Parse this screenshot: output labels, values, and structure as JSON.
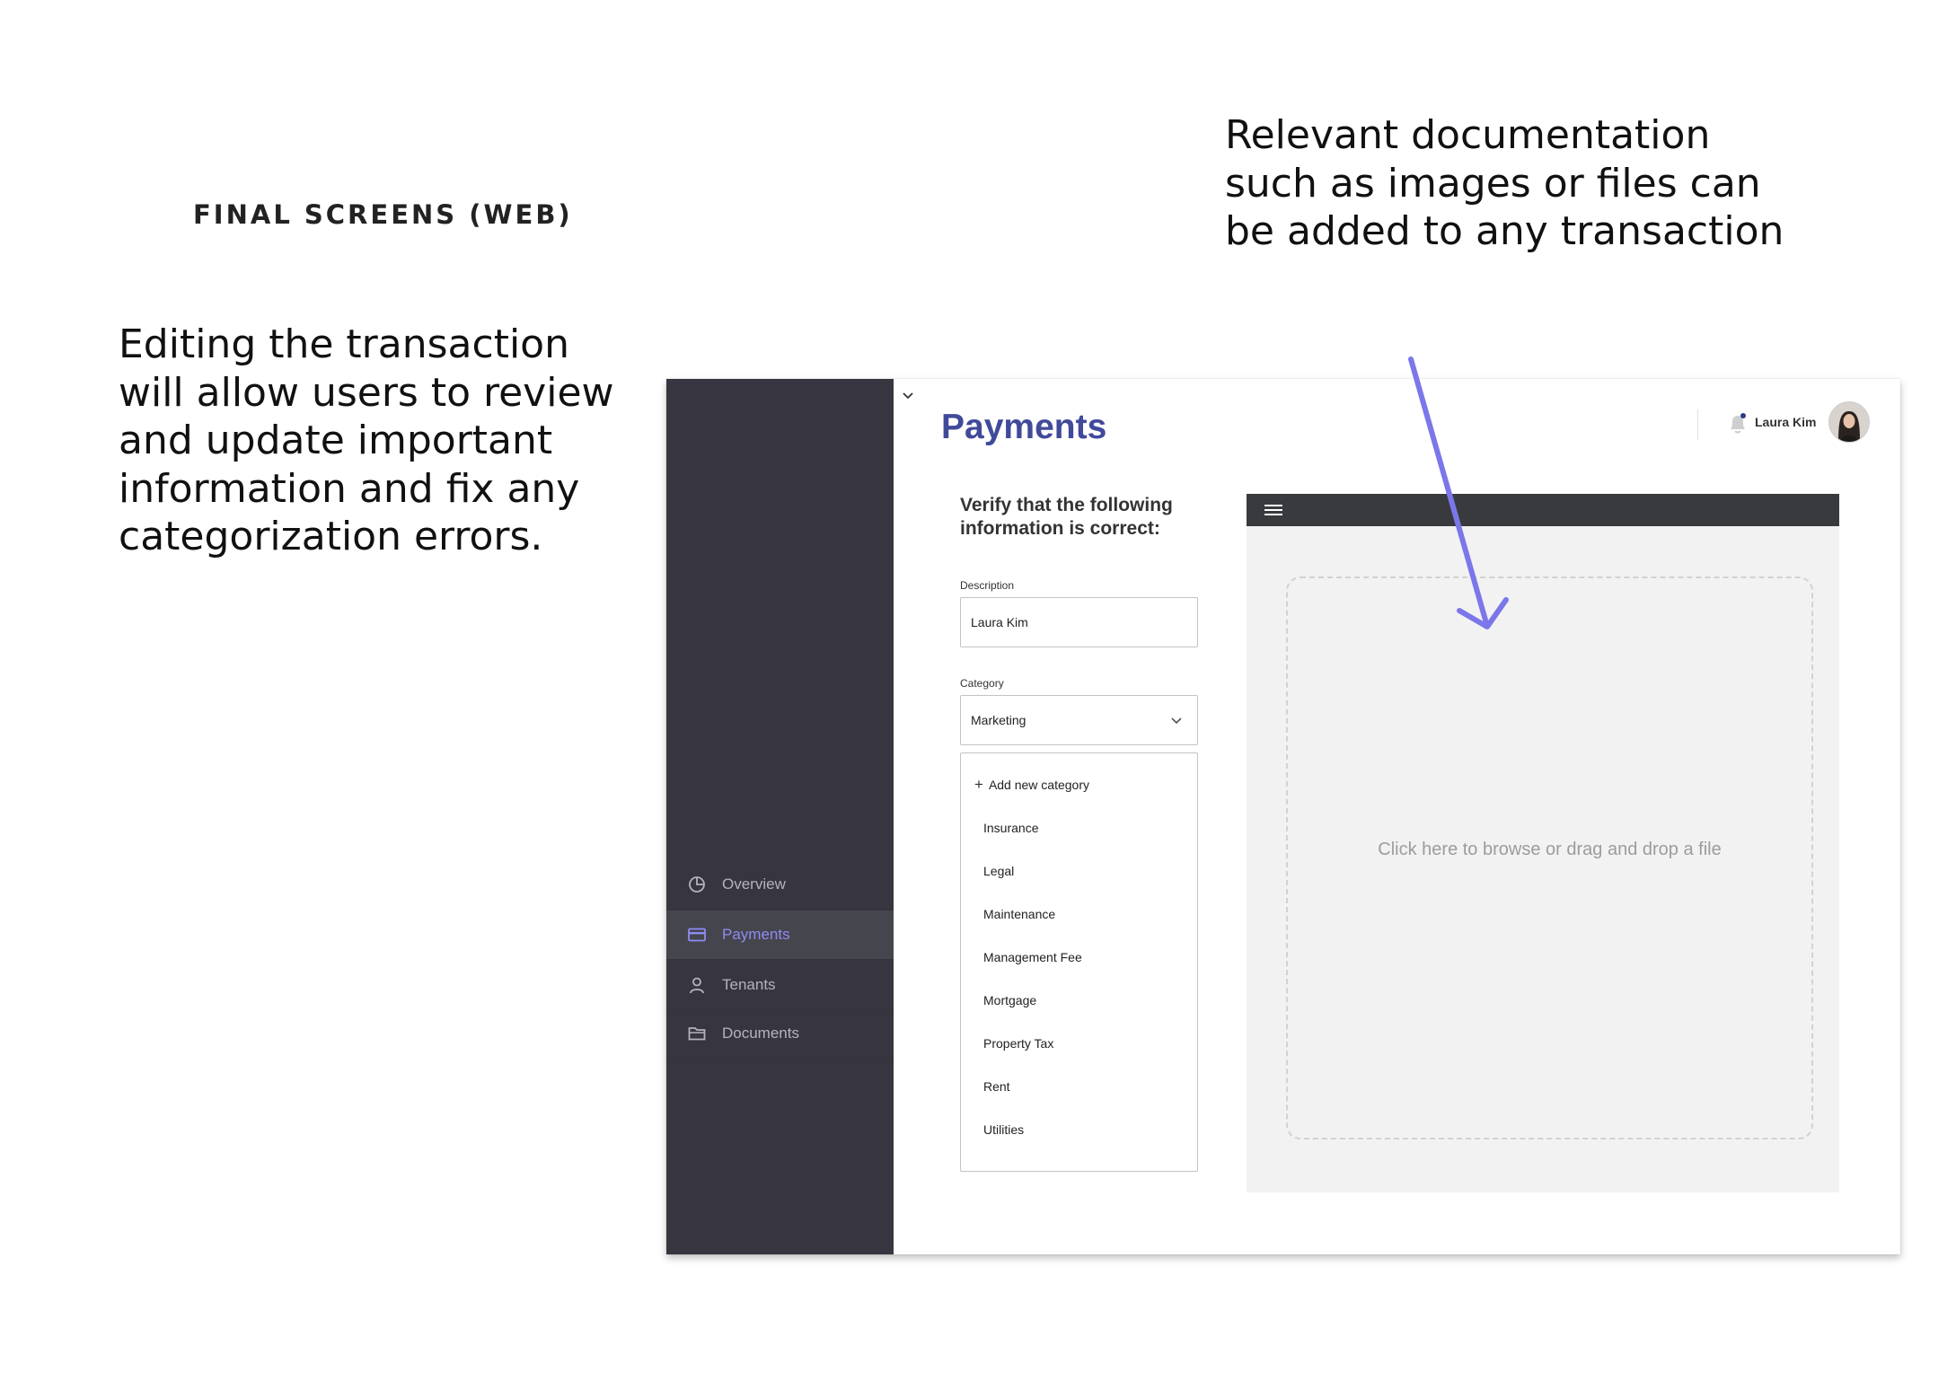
{
  "slide": {
    "section_title": "FINAL SCREENS (WEB)",
    "caption_left": "Editing the transaction will allow users to review and update important information and fix any categorization errors.",
    "caption_right": "Relevant documentation such as images or files can be added to any transaction"
  },
  "sidebar": {
    "items": [
      {
        "label": "Overview",
        "icon": "pie-chart-icon"
      },
      {
        "label": "Payments",
        "icon": "credit-card-icon",
        "active": true
      },
      {
        "label": "Tenants",
        "icon": "person-icon"
      },
      {
        "label": "Documents",
        "icon": "folder-icon"
      }
    ]
  },
  "header": {
    "page_title": "Payments",
    "user_name": "Laura Kim",
    "bell_icon": "bell-icon"
  },
  "form": {
    "heading": "Verify that the following information is correct:",
    "description_label": "Description",
    "description_value": "Laura Kim",
    "category_label": "Category",
    "category_value": "Marketing",
    "add_category_label": "Add new category",
    "category_options": [
      "Insurance",
      "Legal",
      "Maintenance",
      "Management Fee",
      "Mortgage",
      "Property Tax",
      "Rent",
      "Utilities"
    ]
  },
  "upload": {
    "dropzone_text": "Click here to browse or drag and drop a file"
  },
  "colors": {
    "sidebar_bg": "#373640",
    "accent": "#8f8bf0",
    "title": "#414a9a",
    "annotation_arrow": "#7b77ea"
  }
}
